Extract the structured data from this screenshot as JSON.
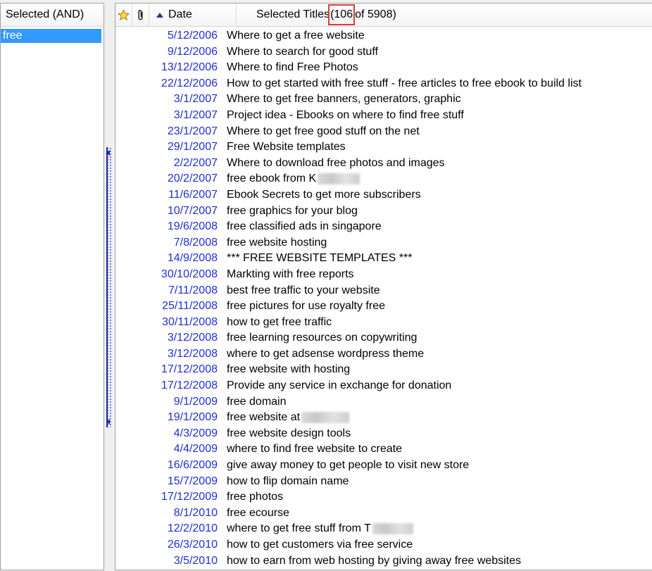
{
  "left_panel": {
    "header": "Selected (AND)",
    "items": [
      "free"
    ]
  },
  "right_panel": {
    "header": {
      "date_label": "Date",
      "titles_label": "Selected Titles ",
      "count_text": "(106 ",
      "count_rest": "of 5908)"
    },
    "icons": {
      "star": "star-icon",
      "attachment": "paperclip-icon",
      "sort": "sort-ascending-icon"
    },
    "rows": [
      {
        "date": "5/12/2006",
        "title": "Where to get a free website"
      },
      {
        "date": "9/12/2006",
        "title": "Where to search for good stuff"
      },
      {
        "date": "13/12/2006",
        "title": "Where to find Free Photos"
      },
      {
        "date": "22/12/2006",
        "title": "How to get started with free stuff - free articles to free ebook to build list"
      },
      {
        "date": "3/1/2007",
        "title": "Where to get free banners, generators, graphic"
      },
      {
        "date": "3/1/2007",
        "title": "Project idea - Ebooks on where to find free stuff"
      },
      {
        "date": "23/1/2007",
        "title": "Where to get free good stuff on the net"
      },
      {
        "date": "29/1/2007",
        "title": "Free Website templates"
      },
      {
        "date": "2/2/2007",
        "title": "Where to download free photos and images"
      },
      {
        "date": "20/2/2007",
        "title": "free ebook from K"
      },
      {
        "date": "11/6/2007",
        "title": "Ebook Secrets to get more subscribers"
      },
      {
        "date": "10/7/2007",
        "title": "free graphics for your blog"
      },
      {
        "date": "19/6/2008",
        "title": "free classified ads in singapore"
      },
      {
        "date": "7/8/2008",
        "title": "free website hosting"
      },
      {
        "date": "14/9/2008",
        "title": "*** FREE WEBSITE TEMPLATES  ***"
      },
      {
        "date": "30/10/2008",
        "title": "Markting with free reports"
      },
      {
        "date": "7/11/2008",
        "title": "best free traffic to your website"
      },
      {
        "date": "25/11/2008",
        "title": "free pictures for use royalty free"
      },
      {
        "date": "30/11/2008",
        "title": "how to get free traffic"
      },
      {
        "date": "3/12/2008",
        "title": "free learning resources on copywriting"
      },
      {
        "date": "3/12/2008",
        "title": "where to get adsense wordpress theme"
      },
      {
        "date": "17/12/2008",
        "title": "free website with hosting"
      },
      {
        "date": "17/12/2008",
        "title": "Provide any service in exchange for donation"
      },
      {
        "date": "9/1/2009",
        "title": "free domain"
      },
      {
        "date": "19/1/2009",
        "title": "free website at"
      },
      {
        "date": "4/3/2009",
        "title": "free website design tools"
      },
      {
        "date": "4/4/2009",
        "title": "where to find free website to create"
      },
      {
        "date": "16/6/2009",
        "title": "give away money to get people to visit new store"
      },
      {
        "date": "15/7/2009",
        "title": "how to flip domain name"
      },
      {
        "date": "17/12/2009",
        "title": "free photos"
      },
      {
        "date": "8/1/2010",
        "title": "free ecourse"
      },
      {
        "date": "12/2/2010",
        "title": "where to get free stuff  from T"
      },
      {
        "date": "26/3/2010",
        "title": "how to get customers via free service"
      },
      {
        "date": "3/5/2010",
        "title": "how to earn from web hosting by giving away free websites"
      }
    ],
    "colors": {
      "date_text": "#1f2fd0",
      "selection": "#3399ff",
      "highlight_box": "#e03a3a"
    }
  }
}
